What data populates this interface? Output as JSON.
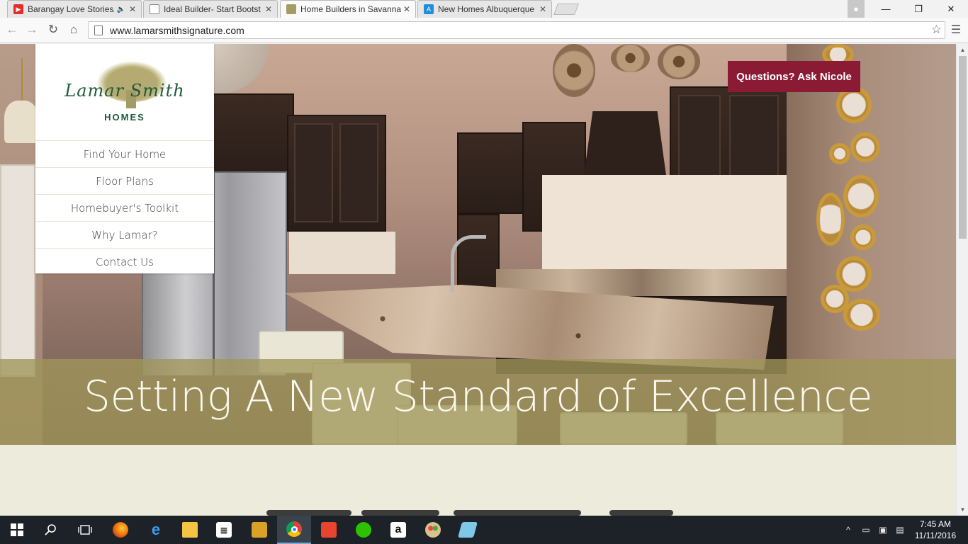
{
  "browser": {
    "tabs": [
      {
        "title": "Barangay Love Stories/",
        "favicon": "youtube-icon",
        "color": "#e52d27",
        "audio": true
      },
      {
        "title": "Ideal Builder- Start Bootst",
        "favicon": "page-icon",
        "color": "#ffffff",
        "audio": false
      },
      {
        "title": "Home Builders in Savanna",
        "favicon": "lamar-smith-icon",
        "color": "#a59b64",
        "audio": false
      },
      {
        "title": "New Homes Albuquerque",
        "favicon": "letter-a-icon",
        "color": "#1e8fd8",
        "audio": false
      }
    ],
    "url": "www.lamarsmithsignature.com"
  },
  "site": {
    "logo": {
      "script": "Lamar Smith",
      "sub": "HOMES"
    },
    "nav": [
      {
        "label": "Find Your Home"
      },
      {
        "label": "Floor Plans"
      },
      {
        "label": "Homebuyer's Toolkit"
      },
      {
        "label": "Why Lamar?"
      },
      {
        "label": "Contact Us"
      }
    ],
    "ask_button": "Questions? Ask Nicole",
    "hero_headline": "Setting A New Standard of Excellence",
    "colors": {
      "brand_green": "#1f5a3a",
      "accent_red": "#8b1a35",
      "band_olive": "#a0965a",
      "page_bg": "#ecebdc"
    }
  },
  "taskbar": {
    "apps": [
      "start-icon",
      "search-icon",
      "task-view-icon",
      "firefox-icon",
      "edge-icon",
      "file-explorer-icon",
      "store-icon",
      "archive-app-icon",
      "chrome-icon",
      "app-icon",
      "wechat-icon",
      "amazon-icon",
      "paint-icon",
      "notepad-icon"
    ],
    "time": "7:45 AM",
    "date": "11/11/2016"
  }
}
